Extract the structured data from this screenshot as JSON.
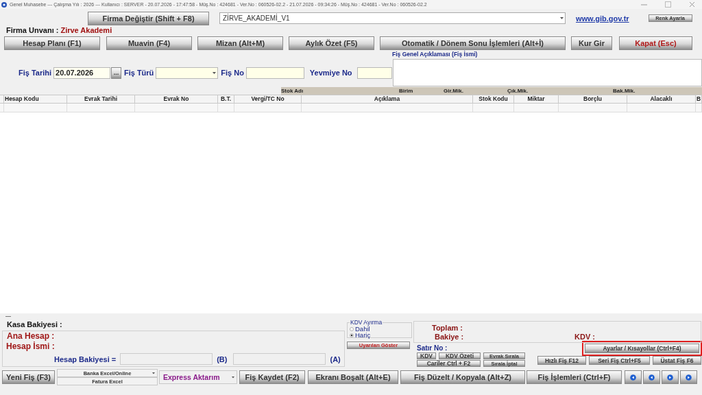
{
  "title_bar": {
    "title": "Genel Muhasebe  ---  Çalışma Yılı : 2026  ---  Kullanıcı : SERVER - 20.07.2026 - 17:47:58 - Müş.No : 424681 - Ver.No : 060526-02.2 - 21.07.2026 - 09:34:26 - Müş.No : 424681 - Ver.No : 060526-02.2"
  },
  "toolbar": {
    "company_button": "Firma Değiştir (Shift + F8)",
    "company_combo": {
      "value": "ZİRVE_AKADEMİ_V1"
    },
    "link": "www.gib.gov.tr",
    "color_button": "Renk Ayarla"
  },
  "company": {
    "label": "Firma Unvanı :",
    "value": "Zirve Akademi"
  },
  "main_buttons": [
    {
      "label": "Hesap Planı (F1)",
      "kind": "normal"
    },
    {
      "label": "Muavin (F4)",
      "kind": "normal"
    },
    {
      "label": "Mizan (Alt+M)",
      "kind": "normal"
    },
    {
      "label": "Aylık Özet (F5)",
      "kind": "normal"
    },
    {
      "label": "Otomatik / Dönem Sonu İşlemleri (Alt+İ)",
      "kind": "normal"
    },
    {
      "label": "Kur Gir",
      "kind": "normal"
    },
    {
      "label": "Kapat (Esc)",
      "kind": "danger"
    }
  ],
  "form": {
    "date": {
      "label": "Fiş Tarihi",
      "value": "20.07.2026",
      "button": "..."
    },
    "type": {
      "label": "Fiş Türü"
    },
    "number": {
      "label": "Fiş No"
    },
    "journal_no": {
      "label": "Yevmiye No"
    },
    "description": {
      "label": "Fiş Genel Açıklaması (Fiş İsmi)"
    }
  },
  "grid": {
    "band_columns": [
      "Stok Adı",
      "Birim",
      "Gir.Mik.",
      "Çık.Mik.",
      "Bak.Mik."
    ],
    "columns": [
      "Hesap Kodu",
      "Evrak Tarihi",
      "Evrak No",
      "B.T.",
      "Vergi/TC No",
      "Açıklama",
      "Stok Kodu",
      "Miktar",
      "Borçlu",
      "Alacaklı",
      "B"
    ]
  },
  "bottom": {
    "cash_balance": "Kasa Bakiyesi :",
    "main_account": "Ana Hesap :",
    "account_name": "Hesap İsmi :",
    "account_balance": "Hesap Bakiyesi =",
    "b_label": "(B)",
    "a_label": "(A)",
    "vat_group": {
      "title": "KDV Ayırma",
      "options": [
        {
          "label": "Dahil",
          "selected": false
        },
        {
          "label": "Hariç",
          "selected": true
        }
      ]
    },
    "warnings_button": "Uyarıları Göster",
    "total": "Toplam :",
    "balance": "Bakiye :",
    "vat": "KDV :",
    "row_no": "Satır No :",
    "small_buttons": [
      "KDV",
      "KDV Özeti",
      "Evrak Sırala",
      "Cariler Ctrl + F2",
      "Sırala İptal"
    ],
    "settings_button": {
      "label": "Ayarlar / Kısayollar (Ctrl+F4)",
      "highlighted": true
    },
    "quick_buttons": [
      "Hızlı Fiş F12",
      "Seri Fiş Ctrl+F5",
      "Üstat Fiş F6"
    ]
  },
  "bottom_bar": {
    "new_button": "Yeni Fiş (F3)",
    "import_options": [
      "Banka Excel/Online",
      "Fatura Excel"
    ],
    "express_combo": "Express Aktarım",
    "buttons": [
      "Fiş Kaydet (F2)",
      "Ekranı Boşalt (Alt+E)",
      "Fiş Düzelt / Kopyala (Alt+Z)",
      "Fiş İşlemleri (Ctrl+F)"
    ]
  }
}
